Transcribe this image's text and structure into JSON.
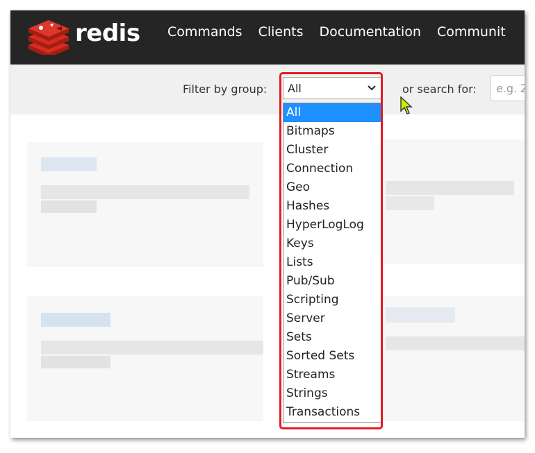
{
  "brand": {
    "name": "redis",
    "logo_icon": "redis-cube-logo-icon",
    "accent": "#dc382d"
  },
  "nav": {
    "items": [
      "Commands",
      "Clients",
      "Documentation",
      "Communit"
    ]
  },
  "filter": {
    "label": "Filter by group:",
    "selected": "All",
    "options": [
      "All",
      "Bitmaps",
      "Cluster",
      "Connection",
      "Geo",
      "Hashes",
      "HyperLogLog",
      "Keys",
      "Lists",
      "Pub/Sub",
      "Scripting",
      "Server",
      "Sets",
      "Sorted Sets",
      "Streams",
      "Strings",
      "Transactions"
    ]
  },
  "search": {
    "label": "or search for:",
    "placeholder": "e.g. Z"
  },
  "colors": {
    "navbar": "#252526",
    "filterbar": "#f0f0f0",
    "selected_option": "#1e90ff",
    "annotation": "#e31b23",
    "cursor": "#c8f000"
  }
}
